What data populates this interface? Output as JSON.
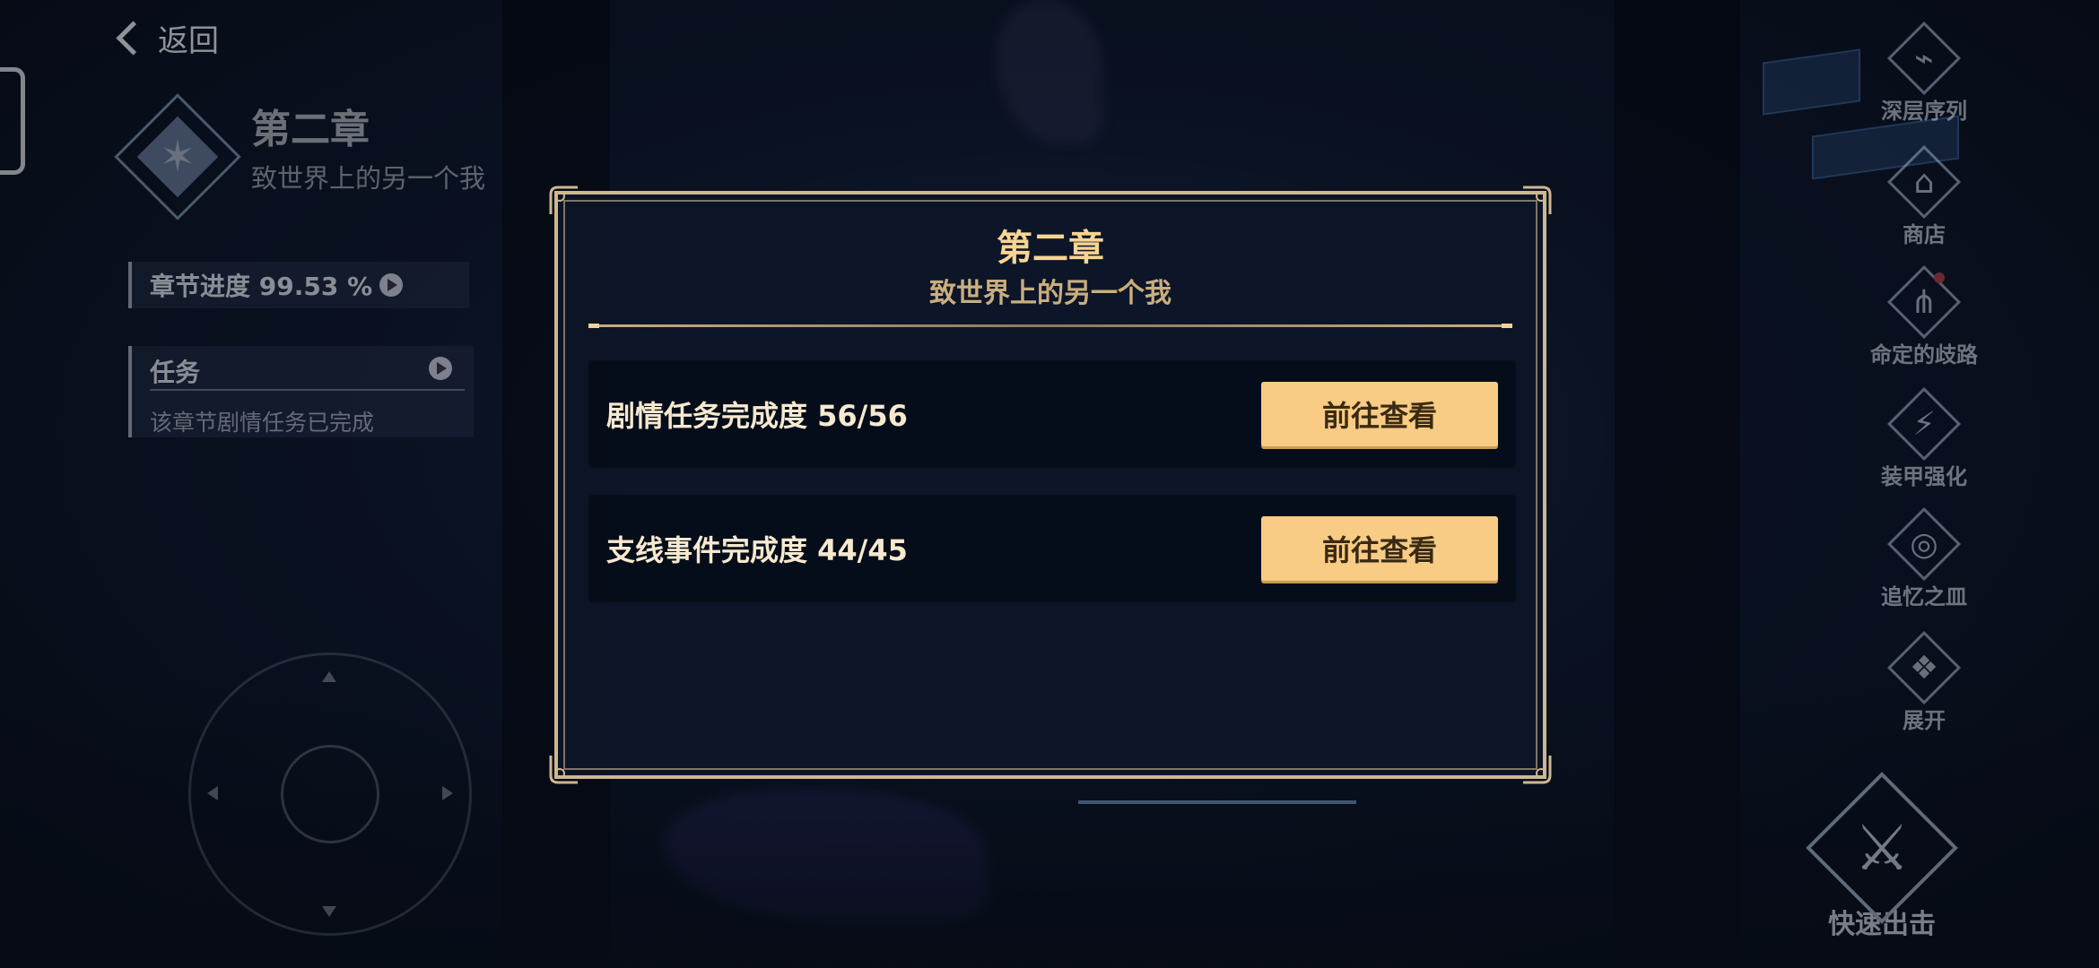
{
  "nav": {
    "back_label": "返回"
  },
  "chapter": {
    "title": "第二章",
    "subtitle": "致世界上的另一个我",
    "progress_label": "章节进度 99.53 %",
    "task_heading": "任务",
    "task_status": "该章节剧情任务已完成"
  },
  "side_menu": [
    {
      "label": "深层序列",
      "icon": "deep-sequence-icon"
    },
    {
      "label": "商店",
      "icon": "shop-icon"
    },
    {
      "label": "命定的歧路",
      "icon": "fated-crossroads-icon"
    },
    {
      "label": "装甲强化",
      "icon": "armor-upgrade-icon"
    },
    {
      "label": "追忆之皿",
      "icon": "memory-vessel-icon"
    },
    {
      "label": "展开",
      "icon": "expand-icon"
    }
  ],
  "quick_sortie": {
    "label": "快速出击",
    "icon": "crossed-swords-icon"
  },
  "dialog": {
    "title": "第二章",
    "subtitle": "致世界上的另一个我",
    "rows": [
      {
        "label": "剧情任务完成度 56/56",
        "button": "前往查看"
      },
      {
        "label": "支线事件完成度 44/45",
        "button": "前往查看"
      }
    ]
  },
  "colors": {
    "accent_gold": "#f8cc84",
    "title_gold": "#f7d592",
    "frame": "#cdb88f"
  }
}
